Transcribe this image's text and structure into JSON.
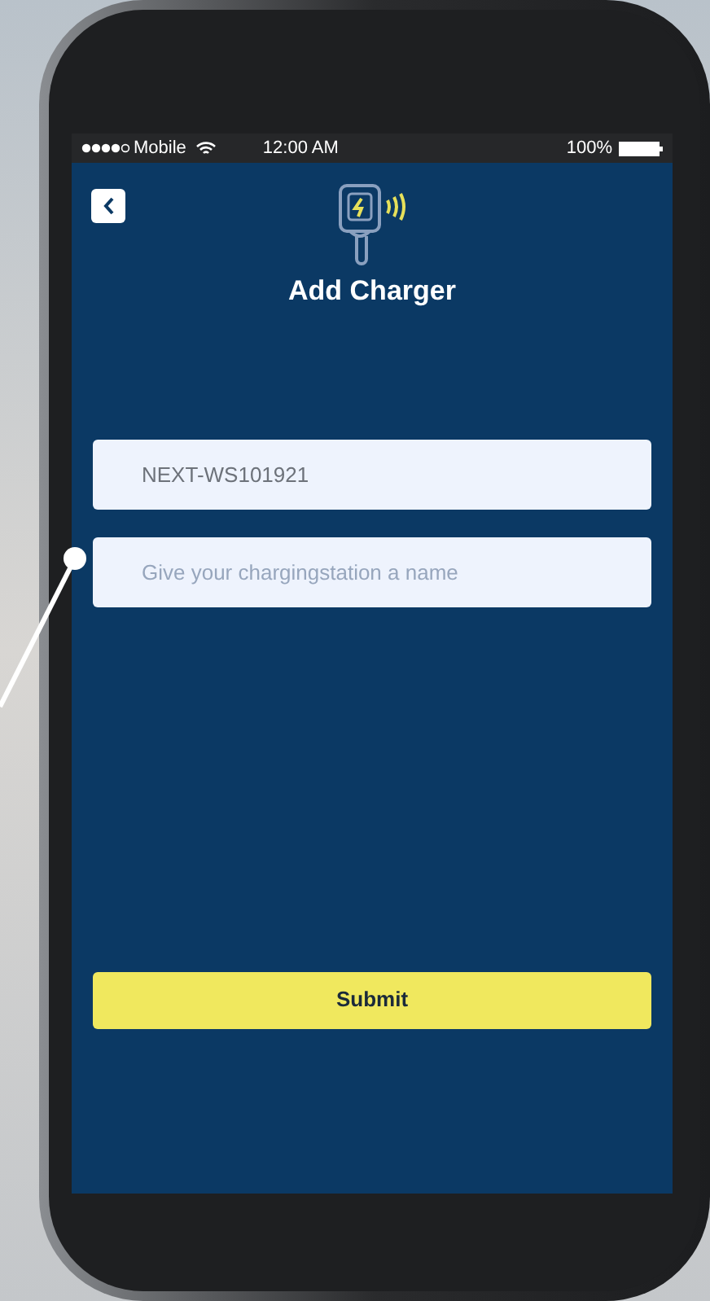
{
  "status_bar": {
    "carrier": "Mobile",
    "time": "12:00 AM",
    "battery": "100%"
  },
  "header": {
    "title": "Add Charger"
  },
  "fields": [
    {
      "value": "NEXT-WS101921"
    },
    {
      "placeholder": "Give your chargingstation a name"
    }
  ],
  "submit_button": {
    "label": "Submit"
  }
}
